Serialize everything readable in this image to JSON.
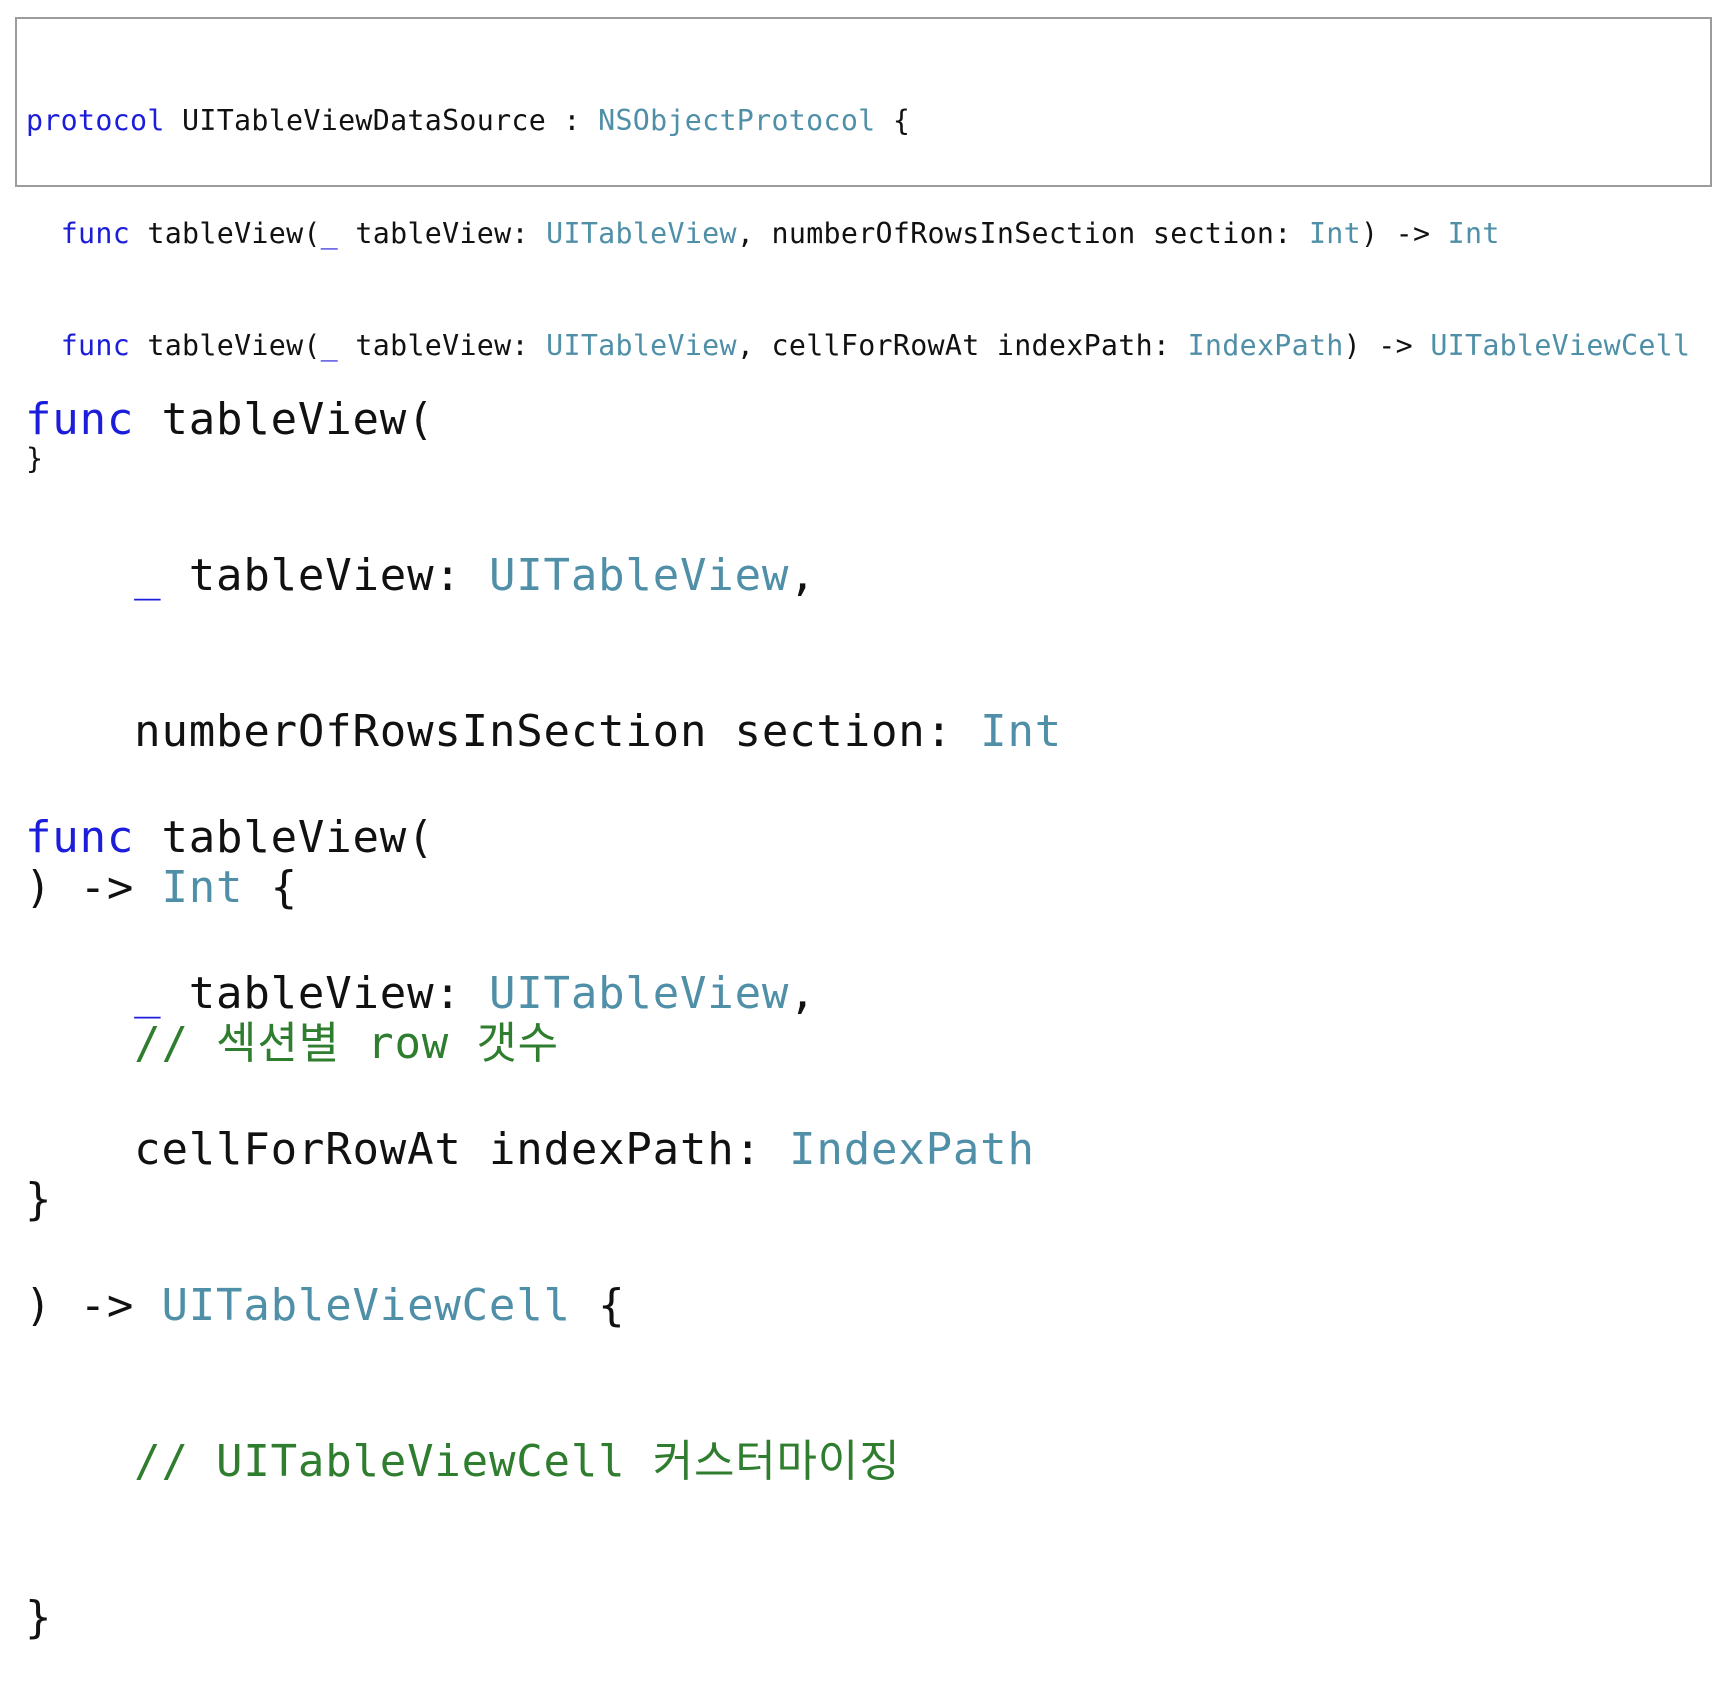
{
  "protocol_snippet": {
    "line1": {
      "keyword": "protocol",
      "name": " UITableViewDataSource : ",
      "parent": "NSObjectProtocol",
      "brace": " {"
    },
    "line2": {
      "indent": "  ",
      "keyword": "func",
      "name": " tableView(",
      "underscore": "_",
      "param": " tableView: ",
      "param_type": "UITableView",
      "rest": ", numberOfRowsInSection section: ",
      "section_type": "Int",
      "arrow": ") -> ",
      "return_type": "Int"
    },
    "line3": {
      "indent": "  ",
      "keyword": "func",
      "name": " tableView(",
      "underscore": "_",
      "param": " tableView: ",
      "param_type": "UITableView",
      "rest": ", cellForRowAt indexPath: ",
      "index_type": "IndexPath",
      "arrow": ") -> ",
      "return_type": "UITableViewCell"
    },
    "line4": {
      "brace": "}"
    }
  },
  "rows_function": {
    "line1": {
      "keyword": "func",
      "name": " tableView("
    },
    "line2": {
      "indent": "    ",
      "underscore": "_",
      "param": " tableView: ",
      "param_type": "UITableView",
      "comma": ","
    },
    "line3": {
      "indent": "    ",
      "label": "numberOfRowsInSection section: ",
      "type": "Int"
    },
    "line4": {
      "paren": ") -> ",
      "return_type": "Int",
      "brace": " {"
    },
    "line5": {
      "indent": "    ",
      "comment_prefix": "// ",
      "comment_ko1": "섹션별",
      "comment_mid": " row ",
      "comment_ko2": "갯수"
    },
    "line6": {
      "brace": "}"
    }
  },
  "cell_function": {
    "line1": {
      "keyword": "func",
      "name": " tableView("
    },
    "line2": {
      "indent": "    ",
      "underscore": "_",
      "param": " tableView: ",
      "param_type": "UITableView",
      "comma": ","
    },
    "line3": {
      "indent": "    ",
      "label": "cellForRowAt indexPath: ",
      "type": "IndexPath"
    },
    "line4": {
      "paren": ") -> ",
      "return_type": "UITableViewCell",
      "brace": " {"
    },
    "line5": {
      "indent": "    ",
      "comment_prefix": "// UITableViewCell ",
      "comment_ko": "커스터마이징"
    },
    "line6": {
      "brace": "}"
    }
  },
  "colors": {
    "keyword": "#1c1cdb",
    "type": "#4f8fa8",
    "comment": "#2f7d2f",
    "plain": "#111111",
    "box_border": "#9c9c9c"
  }
}
